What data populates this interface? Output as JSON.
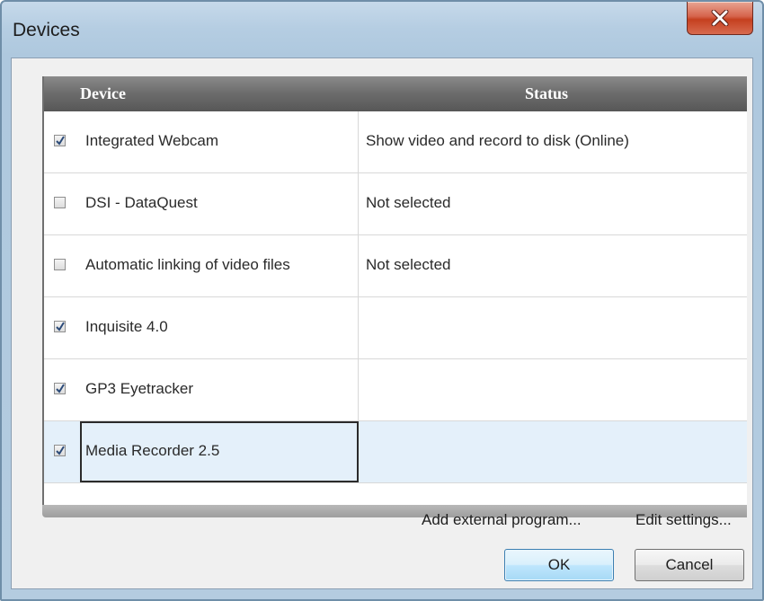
{
  "window": {
    "title": "Devices"
  },
  "table": {
    "headers": {
      "device": "Device",
      "status": "Status"
    },
    "rows": [
      {
        "checked": true,
        "device": "Integrated Webcam",
        "status": "Show video and record to disk (Online)"
      },
      {
        "checked": false,
        "device": "DSI - DataQuest",
        "status": "Not selected"
      },
      {
        "checked": false,
        "device": "Automatic linking of video files",
        "status": "Not selected"
      },
      {
        "checked": true,
        "device": "Inquisite 4.0",
        "status": ""
      },
      {
        "checked": true,
        "device": "GP3 Eyetracker",
        "status": ""
      },
      {
        "checked": true,
        "device": "Media Recorder 2.5",
        "status": "",
        "selected": true
      }
    ]
  },
  "actions": {
    "add_external": "Add external program...",
    "edit_settings": "Edit settings..."
  },
  "buttons": {
    "ok": "OK",
    "cancel": "Cancel"
  },
  "colors": {
    "title_bar": "#b5cde2",
    "close_button": "#c5401f",
    "header_bg": "#6b6b6b",
    "selected_row": "#e4f0fa",
    "ok_button": "#bee6fd"
  }
}
